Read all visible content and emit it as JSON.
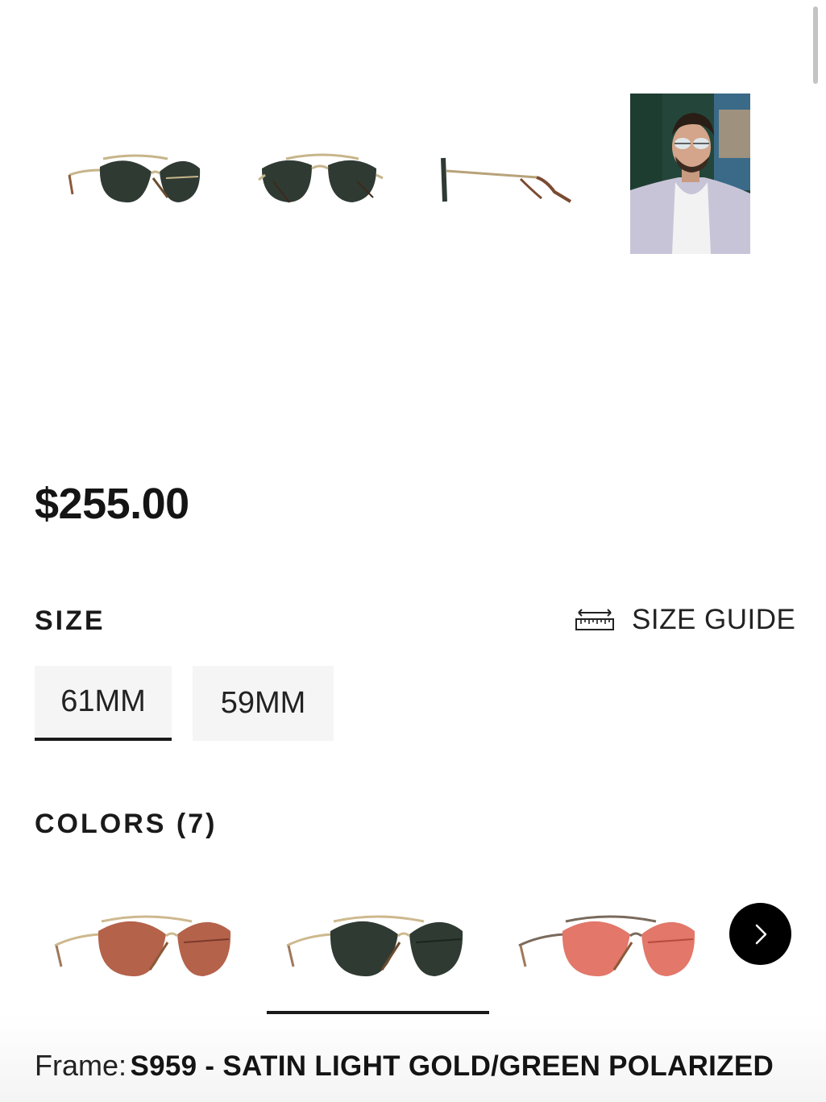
{
  "gallery": {
    "thumbnails": [
      {
        "name": "front-view",
        "lens_color": "#2f3a33",
        "frame_color": "#c7b58a"
      },
      {
        "name": "angled-view",
        "lens_color": "#2f3a33",
        "frame_color": "#c7b58a"
      },
      {
        "name": "side-view",
        "lens_color": "#2f3a33",
        "frame_color": "#b8a27a"
      },
      {
        "name": "model-photo"
      }
    ]
  },
  "product": {
    "price": "$255.00"
  },
  "size": {
    "heading": "SIZE",
    "guide_label": "SIZE GUIDE",
    "options": [
      {
        "label": "61MM",
        "selected": true
      },
      {
        "label": "59MM",
        "selected": false
      }
    ]
  },
  "colors": {
    "heading": "COLORS (7)",
    "swatches": [
      {
        "lens_color": "#b5624b",
        "frame_color": "#cdb98e",
        "selected": false
      },
      {
        "lens_color": "#2f3a33",
        "frame_color": "#cdb98e",
        "selected": true
      },
      {
        "lens_color": "#e2776a",
        "frame_color": "#7a6a5c",
        "selected": false
      }
    ],
    "next_icon": "chevron-right-icon"
  },
  "frame": {
    "label": "Frame:",
    "value": "S959 - SATIN LIGHT GOLD/GREEN POLARIZED"
  },
  "colors_palette": {
    "text": "#1a1a1a",
    "option_bg": "#f5f5f5",
    "next_button_bg": "#000000"
  }
}
